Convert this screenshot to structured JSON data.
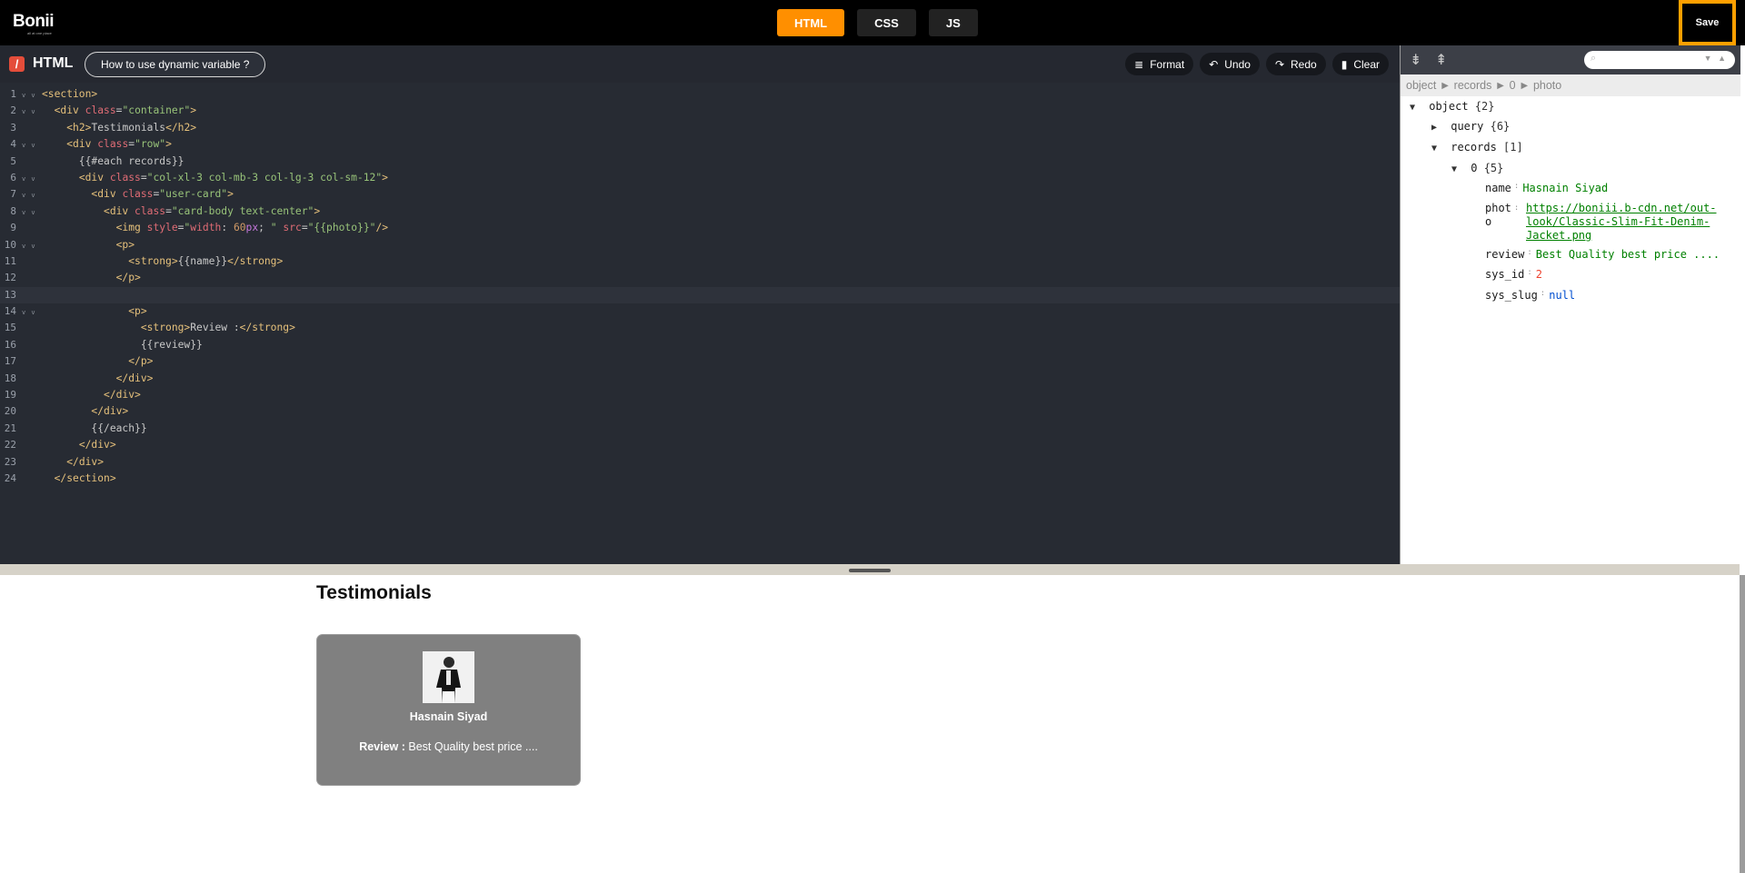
{
  "app": {
    "logo_text": "Bonii",
    "logo_tagline": "all at one place",
    "save_label": "Save"
  },
  "tabs": [
    {
      "label": "HTML",
      "active": true
    },
    {
      "label": "CSS",
      "active": false
    },
    {
      "label": "JS",
      "active": false
    }
  ],
  "editor": {
    "language_title": "HTML",
    "help_label": "How to use dynamic variable ?",
    "toolbar": {
      "format": "Format",
      "undo": "Undo",
      "redo": "Redo",
      "clear": "Clear"
    },
    "line_numbers": [
      "1",
      "2",
      "3",
      "4",
      "5",
      "6",
      "7",
      "8",
      "9",
      "10",
      "11",
      "12",
      "13",
      "14",
      "15",
      "16",
      "17",
      "18",
      "19",
      "20",
      "21",
      "22",
      "23",
      "24"
    ],
    "active_line": 13
  },
  "json_viewer": {
    "breadcrumb": "object ► records ► 0 ► photo",
    "root_label": "object",
    "root_count": "{2}",
    "query_key": "query",
    "query_count": "{6}",
    "records_key": "records",
    "records_count": "[1]",
    "item_index": "0",
    "item_count": "{5}",
    "fields": {
      "name_key": "name",
      "name_value": "Hasnain Siyad",
      "photo_key_1": "phot",
      "photo_key_2": "o",
      "photo_value_1": "https://boniii.b-cdn.net/out-",
      "photo_value_2": "look/Classic-Slim-Fit-Denim-",
      "photo_value_3": "Jacket.png",
      "review_key": "review",
      "review_value": "Best Quality best price ....",
      "sys_id_key": "sys_id",
      "sys_id_value": "2",
      "sys_slug_key": "sys_slug",
      "sys_slug_value": "null"
    }
  },
  "preview": {
    "title": "Testimonials",
    "card": {
      "name": "Hasnain Siyad",
      "review_label": "Review :",
      "review_text": " Best Quality best price ...."
    }
  },
  "colors": {
    "accent": "#ff8f00",
    "save_border": "#ffa000",
    "editor_bg": "#272b33",
    "card_bg": "#808080"
  }
}
